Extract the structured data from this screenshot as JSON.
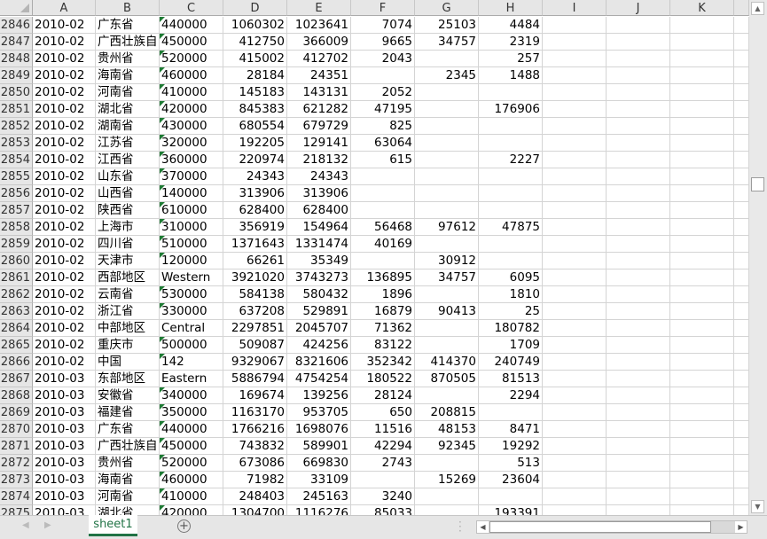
{
  "columns": [
    "A",
    "B",
    "C",
    "D",
    "E",
    "F",
    "G",
    "H",
    "I",
    "J",
    "K"
  ],
  "rows": [
    [
      "2846",
      "2010-02",
      "广东省",
      "440000",
      "1060302",
      "1023641",
      "7074",
      "25103",
      "4484"
    ],
    [
      "2847",
      "2010-02",
      "广西壮族自",
      "450000",
      "412750",
      "366009",
      "9665",
      "34757",
      "2319"
    ],
    [
      "2848",
      "2010-02",
      "贵州省",
      "520000",
      "415002",
      "412702",
      "2043",
      "",
      "257"
    ],
    [
      "2849",
      "2010-02",
      "海南省",
      "460000",
      "28184",
      "24351",
      "",
      "2345",
      "1488"
    ],
    [
      "2850",
      "2010-02",
      "河南省",
      "410000",
      "145183",
      "143131",
      "2052",
      "",
      ""
    ],
    [
      "2851",
      "2010-02",
      "湖北省",
      "420000",
      "845383",
      "621282",
      "47195",
      "",
      "176906"
    ],
    [
      "2852",
      "2010-02",
      "湖南省",
      "430000",
      "680554",
      "679729",
      "825",
      "",
      ""
    ],
    [
      "2853",
      "2010-02",
      "江苏省",
      "320000",
      "192205",
      "129141",
      "63064",
      "",
      ""
    ],
    [
      "2854",
      "2010-02",
      "江西省",
      "360000",
      "220974",
      "218132",
      "615",
      "",
      "2227"
    ],
    [
      "2855",
      "2010-02",
      "山东省",
      "370000",
      "24343",
      "24343",
      "",
      "",
      ""
    ],
    [
      "2856",
      "2010-02",
      "山西省",
      "140000",
      "313906",
      "313906",
      "",
      "",
      ""
    ],
    [
      "2857",
      "2010-02",
      "陕西省",
      "610000",
      "628400",
      "628400",
      "",
      "",
      ""
    ],
    [
      "2858",
      "2010-02",
      "上海市",
      "310000",
      "356919",
      "154964",
      "56468",
      "97612",
      "47875"
    ],
    [
      "2859",
      "2010-02",
      "四川省",
      "510000",
      "1371643",
      "1331474",
      "40169",
      "",
      ""
    ],
    [
      "2860",
      "2010-02",
      "天津市",
      "120000",
      "66261",
      "35349",
      "",
      "30912",
      ""
    ],
    [
      "2861",
      "2010-02",
      "西部地区",
      "Western",
      "3921020",
      "3743273",
      "136895",
      "34757",
      "6095"
    ],
    [
      "2862",
      "2010-02",
      "云南省",
      "530000",
      "584138",
      "580432",
      "1896",
      "",
      "1810"
    ],
    [
      "2863",
      "2010-02",
      "浙江省",
      "330000",
      "637208",
      "529891",
      "16879",
      "90413",
      "25"
    ],
    [
      "2864",
      "2010-02",
      "中部地区",
      "Central",
      "2297851",
      "2045707",
      "71362",
      "",
      "180782"
    ],
    [
      "2865",
      "2010-02",
      "重庆市",
      "500000",
      "509087",
      "424256",
      "83122",
      "",
      "1709"
    ],
    [
      "2866",
      "2010-02",
      "中国",
      "142",
      "9329067",
      "8321606",
      "352342",
      "414370",
      "240749"
    ],
    [
      "2867",
      "2010-03",
      "东部地区",
      "Eastern",
      "5886794",
      "4754254",
      "180522",
      "870505",
      "81513"
    ],
    [
      "2868",
      "2010-03",
      "安徽省",
      "340000",
      "169674",
      "139256",
      "28124",
      "",
      "2294"
    ],
    [
      "2869",
      "2010-03",
      "福建省",
      "350000",
      "1163170",
      "953705",
      "650",
      "208815",
      ""
    ],
    [
      "2870",
      "2010-03",
      "广东省",
      "440000",
      "1766216",
      "1698076",
      "11516",
      "48153",
      "8471"
    ],
    [
      "2871",
      "2010-03",
      "广西壮族自",
      "450000",
      "743832",
      "589901",
      "42294",
      "92345",
      "19292"
    ],
    [
      "2872",
      "2010-03",
      "贵州省",
      "520000",
      "673086",
      "669830",
      "2743",
      "",
      "513"
    ],
    [
      "2873",
      "2010-03",
      "海南省",
      "460000",
      "71982",
      "33109",
      "",
      "15269",
      "23604"
    ],
    [
      "2874",
      "2010-03",
      "河南省",
      "410000",
      "248403",
      "245163",
      "3240",
      "",
      ""
    ],
    [
      "2875",
      "2010-03",
      "湖北省",
      "420000",
      "1304700",
      "1116276",
      "85033",
      "",
      "193391"
    ]
  ],
  "sheet_tab": "sheet1",
  "add_sheet": "+",
  "accent": "#217346"
}
